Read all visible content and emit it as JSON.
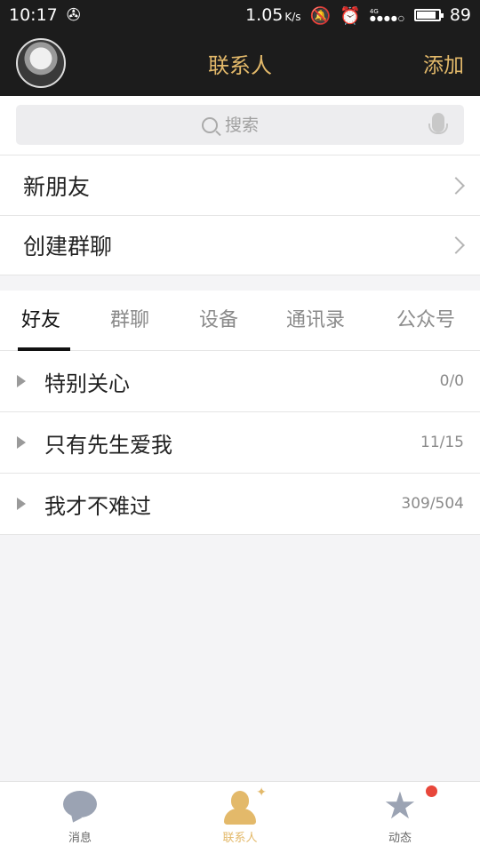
{
  "status_bar": {
    "time": "10:17",
    "speed": "1.05",
    "speed_unit": "K/s",
    "network": "4G",
    "battery": "89",
    "battery_level_percent": 89
  },
  "header": {
    "title": "联系人",
    "add_label": "添加"
  },
  "search": {
    "placeholder": "搜索"
  },
  "rows": [
    {
      "label": "新朋友"
    },
    {
      "label": "创建群聊"
    }
  ],
  "tabs": [
    {
      "label": "好友",
      "active": true
    },
    {
      "label": "群聊",
      "active": false
    },
    {
      "label": "设备",
      "active": false
    },
    {
      "label": "通讯录",
      "active": false
    },
    {
      "label": "公众号",
      "active": false
    }
  ],
  "groups": [
    {
      "name": "特别关心",
      "count": "0/0"
    },
    {
      "name": "只有先生爱我",
      "count": "11/15"
    },
    {
      "name": "我才不难过",
      "count": "309/504"
    }
  ],
  "bottom_nav": [
    {
      "label": "消息",
      "icon": "chat-bubble-icon",
      "active": false
    },
    {
      "label": "联系人",
      "icon": "contacts-icon",
      "active": true
    },
    {
      "label": "动态",
      "icon": "star-icon",
      "active": false,
      "badge": true
    }
  ],
  "colors": {
    "accent": "#e3b96a",
    "header_bg": "#1c1c1c",
    "badge": "#e8473b"
  }
}
